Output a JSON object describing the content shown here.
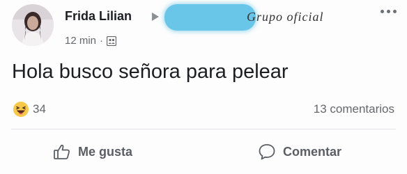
{
  "post": {
    "author": "Frida Lilian",
    "group_name": "Grupo oficial",
    "time": "12 min",
    "separator": "·",
    "body": "Hola busco señora para pelear",
    "reaction_count": "34",
    "comments_label": "13 comentarios"
  },
  "actions": {
    "like_label": "Me gusta",
    "comment_label": "Comentar"
  },
  "icons": {
    "avatar": "profile-photo",
    "arrow": "triangle-right-icon",
    "audience": "group-audience-icon",
    "reaction": "haha-emoji-icon",
    "like": "thumbs-up-icon",
    "comment": "speech-bubble-icon",
    "more": "more-options-icon"
  },
  "colors": {
    "redaction": "#69c6e8",
    "secondary_text": "#65676b"
  }
}
